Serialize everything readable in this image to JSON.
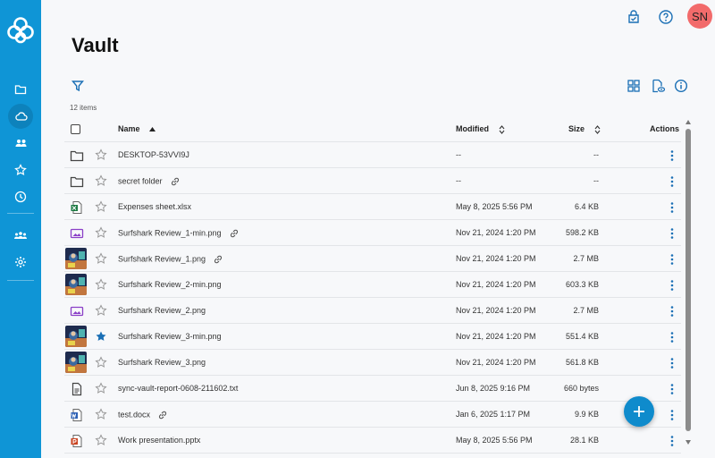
{
  "app": {
    "page_title": "Vault",
    "item_count": "12 items"
  },
  "user": {
    "initials": "SN"
  },
  "colors": {
    "sidebar": "#0f95d6",
    "accent": "#0f8bcc",
    "avatar": "#f26b6b",
    "star_filled": "#1a6fb5"
  },
  "sidebar": {
    "items": [
      {
        "name": "files",
        "icon": "folder-icon"
      },
      {
        "name": "vault",
        "icon": "cloud-icon",
        "active": true
      },
      {
        "name": "shared",
        "icon": "people-icon"
      },
      {
        "name": "starred",
        "icon": "star-icon"
      },
      {
        "name": "recents",
        "icon": "clock-icon"
      },
      {
        "name": "team",
        "icon": "team-icon"
      },
      {
        "name": "settings",
        "icon": "gear-icon"
      }
    ]
  },
  "table": {
    "headers": {
      "name": "Name",
      "modified": "Modified",
      "size": "Size",
      "actions": "Actions"
    },
    "rows": [
      {
        "name": "DESKTOP-53VVI9J",
        "modified": "--",
        "size": "--",
        "type": "folder",
        "starred": false,
        "linked": false
      },
      {
        "name": "secret folder",
        "modified": "--",
        "size": "--",
        "type": "folder",
        "starred": false,
        "linked": true
      },
      {
        "name": "Expenses sheet.xlsx",
        "modified": "May 8, 2025 5:56 PM",
        "size": "6.4 KB",
        "type": "excel",
        "starred": false,
        "linked": false
      },
      {
        "name": "Surfshark Review_1-min.png",
        "modified": "Nov 21, 2024 1:20 PM",
        "size": "598.2 KB",
        "type": "image",
        "starred": false,
        "linked": true
      },
      {
        "name": "Surfshark Review_1.png",
        "modified": "Nov 21, 2024 1:20 PM",
        "size": "2.7 MB",
        "type": "thumb",
        "starred": false,
        "linked": true
      },
      {
        "name": "Surfshark Review_2-min.png",
        "modified": "Nov 21, 2024 1:20 PM",
        "size": "603.3 KB",
        "type": "thumb",
        "starred": false,
        "linked": false
      },
      {
        "name": "Surfshark Review_2.png",
        "modified": "Nov 21, 2024 1:20 PM",
        "size": "2.7 MB",
        "type": "image",
        "starred": false,
        "linked": false
      },
      {
        "name": "Surfshark Review_3-min.png",
        "modified": "Nov 21, 2024 1:20 PM",
        "size": "551.4 KB",
        "type": "thumb",
        "starred": true,
        "linked": false
      },
      {
        "name": "Surfshark Review_3.png",
        "modified": "Nov 21, 2024 1:20 PM",
        "size": "561.8 KB",
        "type": "thumb",
        "starred": false,
        "linked": false
      },
      {
        "name": "sync-vault-report-0608-211602.txt",
        "modified": "Jun 8, 2025 9:16 PM",
        "size": "660 bytes",
        "type": "text",
        "starred": false,
        "linked": false
      },
      {
        "name": "test.docx",
        "modified": "Jan 6, 2025 1:17 PM",
        "size": "9.9 KB",
        "type": "word",
        "starred": false,
        "linked": true
      },
      {
        "name": "Work presentation.pptx",
        "modified": "May 8, 2025 5:56 PM",
        "size": "28.1 KB",
        "type": "powerpoint",
        "starred": false,
        "linked": false
      }
    ]
  }
}
